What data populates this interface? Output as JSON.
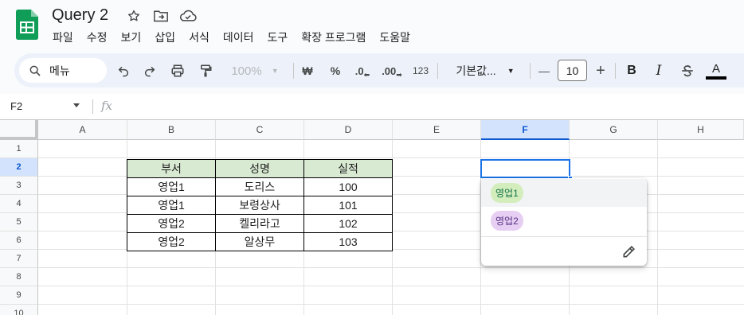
{
  "header": {
    "title": "Query 2",
    "menu": [
      "파일",
      "수정",
      "보기",
      "삽입",
      "서식",
      "데이터",
      "도구",
      "확장 프로그램",
      "도움말"
    ]
  },
  "toolbar": {
    "search_label": "메뉴",
    "zoom": "100%",
    "currency": "₩",
    "percent": "%",
    "dec_decrease": ".0",
    "dec_increase": ".00",
    "format_num": "123",
    "font": "기본값...",
    "minus": "—",
    "font_size": "10",
    "plus": "+",
    "bold": "B",
    "italic": "I",
    "text_color_label": "A"
  },
  "formula_bar": {
    "name_box": "F2",
    "fx": "fx"
  },
  "grid": {
    "columns": [
      "A",
      "B",
      "C",
      "D",
      "E",
      "F",
      "G",
      "H"
    ],
    "rows": [
      "1",
      "2",
      "3",
      "4",
      "5",
      "6",
      "7",
      "8",
      "9",
      "10"
    ],
    "selected_column": "F",
    "selected_row": "2"
  },
  "table": {
    "headers": [
      "부서",
      "성명",
      "실적"
    ],
    "rows": [
      [
        "영업1",
        "도리스",
        "100"
      ],
      [
        "영업1",
        "보령상사",
        "101"
      ],
      [
        "영업2",
        "켈리라고",
        "102"
      ],
      [
        "영업2",
        "알상무",
        "103"
      ]
    ],
    "header_fill": "#d9ead3"
  },
  "dropdown": {
    "options": [
      {
        "label": "영업1",
        "bg": "#d4edbc",
        "fg": "#11734b"
      },
      {
        "label": "영업2",
        "bg": "#e6cff2",
        "fg": "#5a3286"
      }
    ]
  },
  "colors": {
    "accent": "#1a73e8",
    "sheets_green": "#0f9d58"
  }
}
